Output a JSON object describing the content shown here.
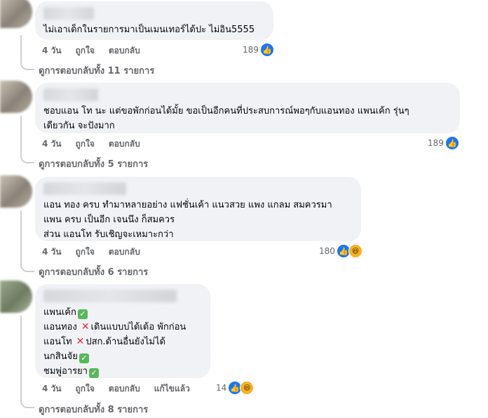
{
  "comments": [
    {
      "text": "ไม่เอาเด็กในรายการมาเป็นเมนเทอร์ได้ปะ ไม่อิน5555",
      "time": "4 วัน",
      "like_label": "ถูกใจ",
      "reply_label": "ตอบกลับ",
      "reaction_count": "189",
      "replies_link": "ดูการตอบกลับทั้ง 11 รายการ"
    },
    {
      "text": "ชอบแอน โท นะ แต่ขอพักก่อนได้มั้ย ขอเป็นอีกคนที่ประสบการณ์พอๆกับแอนทอง แพนเค้ก รุ่นๆ\nเดียวกัน จะปังมาก",
      "time": "4 วัน",
      "like_label": "ถูกใจ",
      "reply_label": "ตอบกลับ",
      "reaction_count": "189",
      "replies_link": "ดูการตอบกลับทั้ง 5 รายการ"
    },
    {
      "text": "แอน ทอง ครบ ทำมาหลายอย่าง แฟชั่นเค้า แนวสวย แพง แกลม สมควรมา\nแพน ครบ เป็นอีก เจนนึง ก็สมควร\nส่วน แอนโท รับเชิญจะเหมาะกว่า",
      "time": "4 วัน",
      "like_label": "ถูกใจ",
      "reply_label": "ตอบกลับ",
      "reaction_count": "180",
      "replies_link": "ดูการตอบกลับทั้ง 6 รายการ"
    },
    {
      "lines": [
        {
          "text": "แพนเค้ก",
          "mark": "check"
        },
        {
          "text": "แอนทอง",
          "mark_before": "cross",
          "rest": "เดินแบบบ่ได้เด้อ พักก่อน"
        },
        {
          "text": "แอนโท",
          "mark_before": "cross",
          "rest": "ปสก.ด้านอื่นยังไม่ได้"
        },
        {
          "text": "นกสินจัย",
          "mark": "check"
        },
        {
          "text": "ชมพู่อารยา",
          "mark": "check"
        }
      ],
      "time": "4 วัน",
      "like_label": "ถูกใจ",
      "reply_label": "ตอบกลับ",
      "edited_label": "แก้ไขแล้ว",
      "reaction_count": "14",
      "replies_link": "ดูการตอบกลับทั้ง 8 รายการ"
    }
  ],
  "icons": {
    "like": "like-reaction-icon",
    "haha": "haha-reaction-icon",
    "check": "check-mark-icon",
    "cross": "cross-mark-icon"
  },
  "colors": {
    "bubble": "#f0f2f5",
    "like_blue": "#1877f2",
    "meta_text": "#65676b",
    "check_green": "#5ab75b",
    "cross_red": "#e0303a"
  }
}
